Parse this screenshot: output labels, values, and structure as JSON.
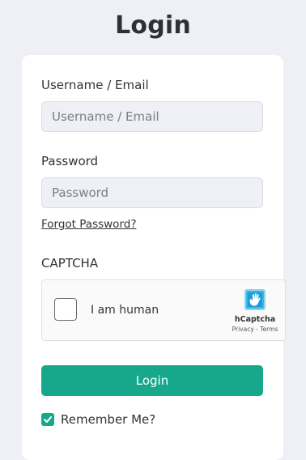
{
  "page": {
    "title": "Login"
  },
  "username": {
    "label": "Username / Email",
    "placeholder": "Username / Email",
    "value": ""
  },
  "password": {
    "label": "Password",
    "placeholder": "Password",
    "value": ""
  },
  "forgot_password": {
    "label": "Forgot Password?"
  },
  "captcha": {
    "label": "CAPTCHA",
    "checkbox_text": "I am human",
    "checked": false,
    "brand": "hCaptcha",
    "privacy_link": "Privacy",
    "separator": " - ",
    "terms_link": "Terms",
    "logo_icon": "hcaptcha-hand-icon"
  },
  "login_button": {
    "label": "Login",
    "color": "#17a88b"
  },
  "remember_me": {
    "label": "Remember Me?",
    "checked": true,
    "icon": "check-icon"
  },
  "colors": {
    "background": "#eef0f5",
    "card": "#ffffff",
    "accent": "#17a88b",
    "input_background": "#eef0f5"
  }
}
